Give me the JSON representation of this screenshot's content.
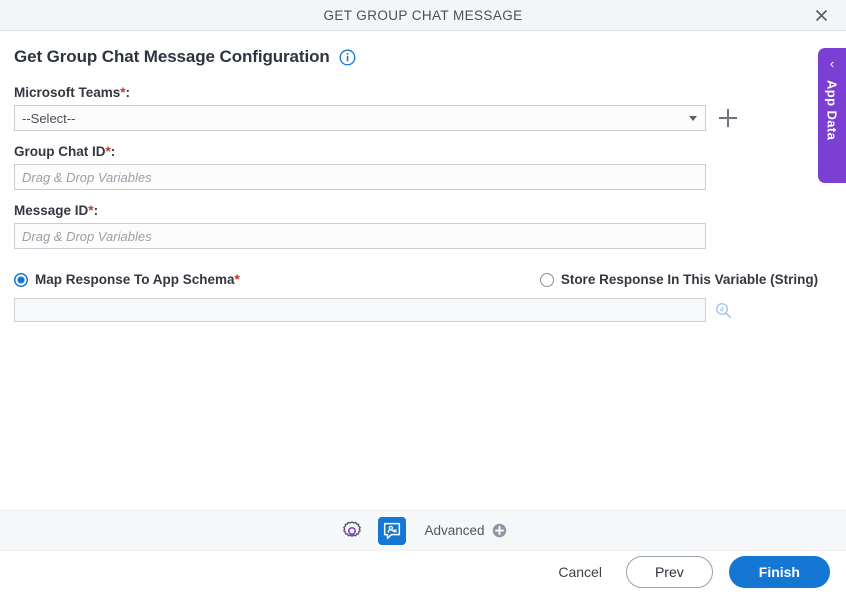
{
  "window": {
    "title": "GET GROUP CHAT MESSAGE",
    "close_icon": "close-icon"
  },
  "heading": {
    "text": "Get Group Chat Message Configuration",
    "info_icon": "info-icon"
  },
  "form": {
    "teams": {
      "label": "Microsoft Teams",
      "required_mark": "*",
      "colon": ":",
      "selected_value": "--Select--",
      "caret_icon": "chevron-down-icon",
      "add_icon": "plus-icon"
    },
    "group_chat_id": {
      "label": "Group Chat ID",
      "required_mark": "*",
      "colon": ":",
      "value": "",
      "placeholder": "Drag & Drop Variables"
    },
    "message_id": {
      "label": "Message ID",
      "required_mark": "*",
      "colon": ":",
      "value": "",
      "placeholder": "Drag & Drop Variables"
    },
    "response_option": {
      "map_schema_label": "Map Response To App Schema",
      "map_schema_required": "*",
      "map_schema_selected": true,
      "store_variable_label": "Store Response In This Variable (String)",
      "store_variable_selected": false
    },
    "schema_search": {
      "value": "",
      "placeholder": "",
      "search_icon": "search-icon"
    }
  },
  "app_data_tab": {
    "label": "App Data",
    "chevron": "‹",
    "color": "#7c3fd4"
  },
  "toolbar": {
    "settings_icon": "gear-icon",
    "chat_icon": "chat-user-icon",
    "advanced_label": "Advanced",
    "advanced_add_icon": "plus-circle-icon"
  },
  "footer": {
    "cancel_label": "Cancel",
    "prev_label": "Prev",
    "finish_label": "Finish"
  },
  "colors": {
    "accent_blue": "#1477d4",
    "purple": "#7c3fd4",
    "required_red": "#c0392b"
  }
}
